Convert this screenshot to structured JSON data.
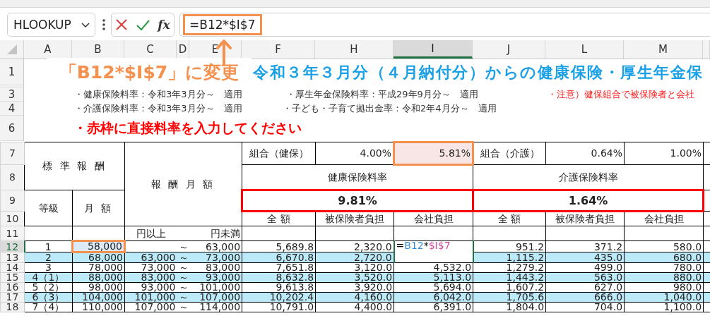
{
  "name_box": {
    "value": "HLOOKUP"
  },
  "formula_bar": {
    "fx": "fx",
    "value": "=B12*$I$7",
    "highlighted": true
  },
  "annotation": {
    "text": "「B12*$I$7」に変更"
  },
  "columns": [
    {
      "label": "A",
      "selected": false
    },
    {
      "label": "B",
      "selected": false
    },
    {
      "label": "C",
      "selected": false
    },
    {
      "label": "D",
      "selected": false
    },
    {
      "label": "E",
      "selected": false
    },
    {
      "label": "F",
      "selected": false
    },
    {
      "label": "H",
      "selected": false
    },
    {
      "label": "I",
      "selected": true
    },
    {
      "label": "J",
      "selected": false
    },
    {
      "label": "L",
      "selected": false
    },
    {
      "label": "M",
      "selected": false
    }
  ],
  "title_row": {
    "label": "1",
    "text": "令和３年３月分（４月納付分）からの健康保険・厚生年金保"
  },
  "note_rows": [
    {
      "label": "3",
      "items": [
        {
          "kind": "normal",
          "text": "・健康保険料率：令和3年3月分～　適用"
        },
        {
          "kind": "normal",
          "text": "・厚生年金保険料率：平成29年9月分～　適用"
        },
        {
          "kind": "warning",
          "text": "・注意）健保組合で被保険者と会社"
        }
      ]
    },
    {
      "label": "4",
      "items": [
        {
          "kind": "normal",
          "text": "・介護保険料率：令和3年3月分～　適用"
        },
        {
          "kind": "normal",
          "text": "・子ども・子育て拠出金率：令和2年4月分～　適用"
        }
      ]
    }
  ],
  "instruction_row": {
    "label": "6",
    "text": "・赤枠に直接料率を入力してください"
  },
  "table": {
    "row_labels": [
      "7",
      "8",
      "9",
      "10",
      "11"
    ],
    "standard_pay": "標 準 報 酬",
    "pay_range": "報 酬 月 額",
    "rates": [
      {
        "kind": "label",
        "text": "組合（健保）",
        "highlighted": false
      },
      {
        "kind": "value",
        "text": "4.00%",
        "highlighted": false
      },
      {
        "kind": "value",
        "text": "5.81%",
        "highlighted": true
      },
      {
        "kind": "label",
        "text": "組合（介護）",
        "highlighted": false
      },
      {
        "kind": "value",
        "text": "0.64%",
        "highlighted": false
      },
      {
        "kind": "value",
        "text": "1.00%",
        "highlighted": false
      }
    ],
    "health_rate_label": "健康保険料率",
    "care_rate_label": "介護保険料率",
    "health_total": "9.81%",
    "care_total": "1.64%",
    "grade": "等級",
    "monthly": "月 額",
    "sub_headers": [
      "全 額",
      "被保険者負担",
      "会社負担",
      "全 額",
      "被保険者負担",
      "会社負担"
    ],
    "from_unit": "円以上",
    "to_unit": "円未満"
  },
  "rows": [
    {
      "label": "12",
      "selected": true,
      "shaded": false,
      "referenced": true,
      "editing": true,
      "grade": "1",
      "monthly": "58,000",
      "sep": "～",
      "to": "63,000",
      "f": "5,689.8",
      "h": "2,320.0",
      "formula": [
        {
          "text": "=",
          "color": "#000000"
        },
        {
          "text": "B12",
          "color": "#3a8ed8"
        },
        {
          "text": "*",
          "color": "#000000"
        },
        {
          "text": "$I$7",
          "color": "#d0499a"
        }
      ],
      "j": "951.2",
      "l": "371.2",
      "m": "580.0"
    },
    {
      "label": "13",
      "selected": false,
      "shaded": true,
      "referenced": false,
      "editing": false,
      "grade": "2",
      "monthly": "68,000",
      "from": "63,000",
      "sep": "～",
      "to": "73,000",
      "f": "6,670.8",
      "h": "2,720.0",
      "j": "1,115.2",
      "l": "435.0",
      "m": "680.0"
    },
    {
      "label": "14",
      "selected": false,
      "shaded": false,
      "referenced": false,
      "editing": false,
      "grade": "3",
      "monthly": "78,000",
      "from": "73,000",
      "sep": "～",
      "to": "83,000",
      "f": "7,651.8",
      "h": "3,120.0",
      "i": "4,532.0",
      "j": "1,279.2",
      "l": "499.0",
      "m": "780.0"
    },
    {
      "label": "15",
      "selected": false,
      "shaded": true,
      "referenced": false,
      "editing": false,
      "grade": "4（1）",
      "monthly": "88,000",
      "from": "83,000",
      "sep": "～",
      "to": "93,000",
      "f": "8,632.8",
      "h": "3,520.0",
      "i": "5,113.0",
      "j": "1,443.2",
      "l": "563.0",
      "m": "880.0"
    },
    {
      "label": "16",
      "selected": false,
      "shaded": false,
      "referenced": false,
      "editing": false,
      "grade": "5（2）",
      "monthly": "98,000",
      "from": "93,000",
      "sep": "～",
      "to": "101,000",
      "f": "9,613.8",
      "h": "3,920.0",
      "i": "5,694.0",
      "j": "1,607.2",
      "l": "627.0",
      "m": "980.0"
    },
    {
      "label": "17",
      "selected": false,
      "shaded": true,
      "referenced": false,
      "editing": false,
      "grade": "6（3）",
      "monthly": "104,000",
      "from": "101,000",
      "sep": "～",
      "to": "107,000",
      "f": "10,202.4",
      "h": "4,160.0",
      "i": "6,042.0",
      "j": "1,705.6",
      "l": "666.0",
      "m": "1,040.0"
    },
    {
      "label": "18",
      "selected": false,
      "shaded": false,
      "referenced": false,
      "editing": false,
      "grade": "7（4）",
      "monthly": "110,000",
      "from": "107,000",
      "sep": "～",
      "to": "114,000",
      "f": "10,791.0",
      "h": "4,400.0",
      "i": "6,391.0",
      "j": "1,804.0",
      "l": "704.0",
      "m": "1,100.0"
    }
  ]
}
